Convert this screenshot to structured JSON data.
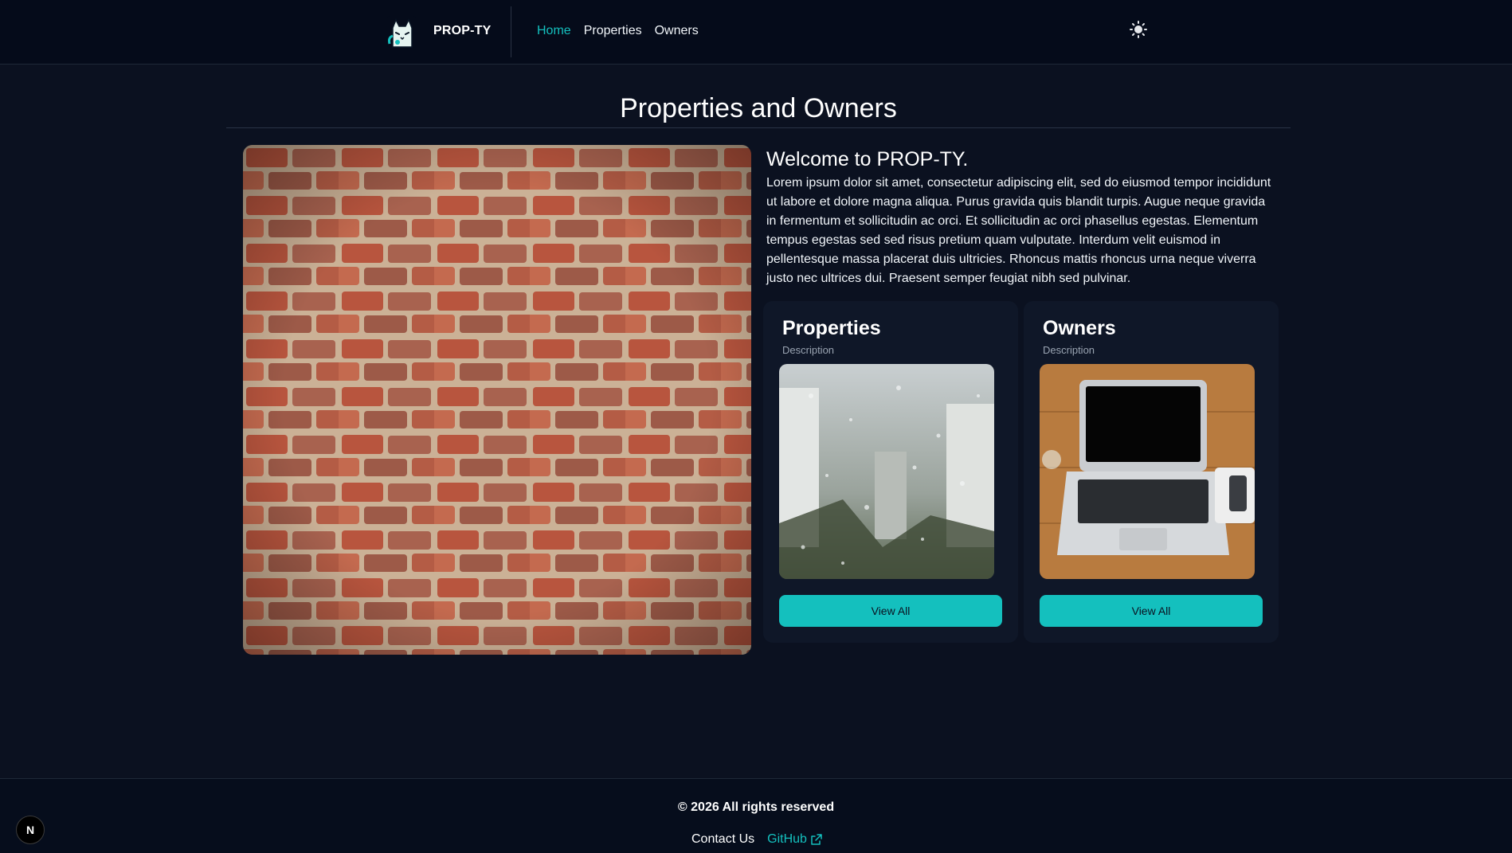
{
  "header": {
    "brand": "PROP-TY",
    "logo_icon": "cat-logo-icon",
    "nav": [
      {
        "label": "Home",
        "active": true
      },
      {
        "label": "Properties",
        "active": false
      },
      {
        "label": "Owners",
        "active": false
      }
    ],
    "theme_toggle_icon": "sun-icon"
  },
  "main": {
    "title": "Properties and Owners",
    "hero_image": "brick-wall-image",
    "welcome_title": "Welcome to PROP-TY.",
    "welcome_text": "Lorem ipsum dolor sit amet, consectetur adipiscing elit, sed do eiusmod tempor incididunt ut labore et dolore magna aliqua. Purus gravida quis blandit turpis. Augue neque gravida in fermentum et sollicitudin ac orci. Et sollicitudin ac orci phasellus egestas. Elementum tempus egestas sed sed risus pretium quam vulputate. Interdum velit euismod in pellentesque massa placerat duis ultricies. Rhoncus mattis rhoncus urna neque viverra justo nec ultrices dui. Praesent semper feugiat nibh sed pulvinar.",
    "cards": [
      {
        "title": "Properties",
        "description": "Description",
        "image": "rainy-window-city-image",
        "button": "View All"
      },
      {
        "title": "Owners",
        "description": "Description",
        "image": "laptop-on-desk-image",
        "button": "View All"
      }
    ]
  },
  "footer": {
    "copyright": "© 2026 All rights reserved",
    "contact": "Contact Us",
    "github": "GitHub",
    "github_icon": "external-link-icon",
    "dev_badge": "N"
  },
  "colors": {
    "background": "#0b1120",
    "header": "#050b1a",
    "card": "#0f1728",
    "accent": "#14c0be"
  }
}
